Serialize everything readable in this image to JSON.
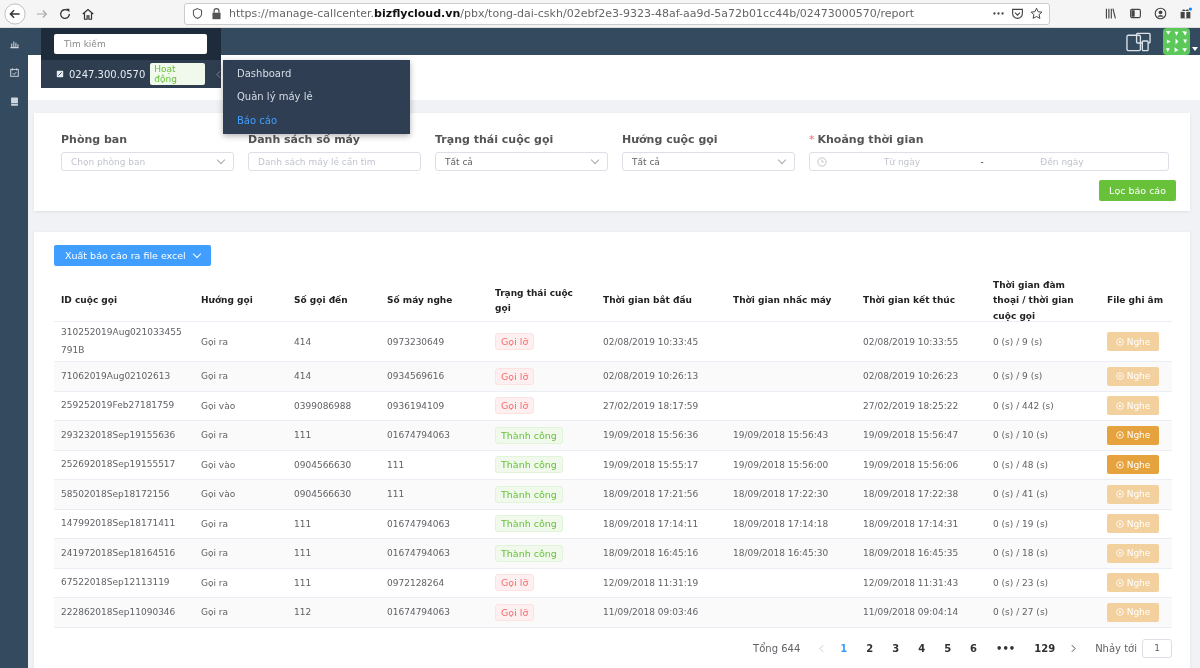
{
  "browser": {
    "url": "https://manage-callcenter.**bizflycloud.vn**/pbx/tong-dai-cskh/02ebf2e3-9323-48af-aa9d-5a72b01cc44b/02473000570/report"
  },
  "search": {
    "placeholder": "Tìm kiếm"
  },
  "line": {
    "number": "0247.300.0570",
    "status": "Hoạt động"
  },
  "menu": [
    {
      "label": "Dashboard",
      "selected": false
    },
    {
      "label": "Quản lý máy lẻ",
      "selected": false
    },
    {
      "label": "Báo cáo",
      "selected": true
    }
  ],
  "filters": {
    "department": {
      "label": "Phòng ban",
      "placeholder": "Chọn phòng ban"
    },
    "extensions": {
      "label": "Danh sách số máy",
      "placeholder": "Danh sách máy lẻ cần tìm"
    },
    "call_status": {
      "label": "Trạng thái cuộc gọi",
      "value": "Tất cả"
    },
    "direction": {
      "label": "Hướng cuộc gọi",
      "value": "Tất cả"
    },
    "period": {
      "label": "Khoảng thời gian",
      "required_mark": "*",
      "from_placeholder": "Từ ngày",
      "separator": "-",
      "to_placeholder": "Đến ngày"
    },
    "submit": "Lọc báo cáo"
  },
  "export_button": "Xuất báo cáo ra file excel",
  "table": {
    "columns": [
      "ID cuộc gọi",
      "Hướng gọi",
      "Số gọi đến",
      "Số máy nghe",
      "Trạng thái cuộc gọi",
      "Thời gian bắt đầu",
      "Thời gian nhấc máy",
      "Thời gian kết thúc",
      "Thời gian đàm thoại / thời gian cuộc gọi",
      "File ghi âm"
    ],
    "rows": [
      {
        "id": "310252019Aug021033455791B",
        "direction": "Gọi ra",
        "caller": "414",
        "receiver": "0973230649",
        "status": {
          "label": "Gọi lỡ",
          "kind": "missed"
        },
        "start": "02/08/2019 10:33:45",
        "answered": "",
        "end": "02/08/2019 10:33:55",
        "duration": "0 (s) / 9 (s)",
        "play": {
          "label": "Nghe",
          "disabled": true
        }
      },
      {
        "id": "71062019Aug02102613",
        "direction": "Gọi ra",
        "caller": "414",
        "receiver": "0934569616",
        "status": {
          "label": "Gọi lỡ",
          "kind": "missed"
        },
        "start": "02/08/2019 10:26:13",
        "answered": "",
        "end": "02/08/2019 10:26:23",
        "duration": "0 (s) / 9 (s)",
        "play": {
          "label": "Nghe",
          "disabled": true
        }
      },
      {
        "id": "259252019Feb27181759",
        "direction": "Gọi vào",
        "caller": "0399086988",
        "receiver": "0936194109",
        "status": {
          "label": "Gọi lỡ",
          "kind": "missed"
        },
        "start": "27/02/2019 18:17:59",
        "answered": "",
        "end": "27/02/2019 18:25:22",
        "duration": "0 (s) / 442 (s)",
        "play": {
          "label": "Nghe",
          "disabled": true
        }
      },
      {
        "id": "293232018Sep19155636",
        "direction": "Gọi ra",
        "caller": "111",
        "receiver": "01674794063",
        "status": {
          "label": "Thành công",
          "kind": "success"
        },
        "start": "19/09/2018 15:56:36",
        "answered": "19/09/2018 15:56:43",
        "end": "19/09/2018 15:56:47",
        "duration": "0 (s) / 10 (s)",
        "play": {
          "label": "Nghe",
          "disabled": false
        }
      },
      {
        "id": "252692018Sep19155517",
        "direction": "Gọi vào",
        "caller": "0904566630",
        "receiver": "111",
        "status": {
          "label": "Thành công",
          "kind": "success"
        },
        "start": "19/09/2018 15:55:17",
        "answered": "19/09/2018 15:56:00",
        "end": "19/09/2018 15:56:06",
        "duration": "0 (s) / 48 (s)",
        "play": {
          "label": "Nghe",
          "disabled": false
        }
      },
      {
        "id": "58502018Sep18172156",
        "direction": "Gọi vào",
        "caller": "0904566630",
        "receiver": "111",
        "status": {
          "label": "Thành công",
          "kind": "success"
        },
        "start": "18/09/2018 17:21:56",
        "answered": "18/09/2018 17:22:30",
        "end": "18/09/2018 17:22:38",
        "duration": "0 (s) / 41 (s)",
        "play": {
          "label": "Nghe",
          "disabled": true
        }
      },
      {
        "id": "147992018Sep18171411",
        "direction": "Gọi ra",
        "caller": "111",
        "receiver": "01674794063",
        "status": {
          "label": "Thành công",
          "kind": "success"
        },
        "start": "18/09/2018 17:14:11",
        "answered": "18/09/2018 17:14:18",
        "end": "18/09/2018 17:14:31",
        "duration": "0 (s) / 19 (s)",
        "play": {
          "label": "Nghe",
          "disabled": true
        }
      },
      {
        "id": "241972018Sep18164516",
        "direction": "Gọi ra",
        "caller": "111",
        "receiver": "01674794063",
        "status": {
          "label": "Thành công",
          "kind": "success"
        },
        "start": "18/09/2018 16:45:16",
        "answered": "18/09/2018 16:45:30",
        "end": "18/09/2018 16:45:35",
        "duration": "0 (s) / 18 (s)",
        "play": {
          "label": "Nghe",
          "disabled": true
        }
      },
      {
        "id": "67522018Sep12113119",
        "direction": "Gọi ra",
        "caller": "111",
        "receiver": "0972128264",
        "status": {
          "label": "Gọi lỡ",
          "kind": "missed"
        },
        "start": "12/09/2018 11:31:19",
        "answered": "",
        "end": "12/09/2018 11:31:43",
        "duration": "0 (s) / 23 (s)",
        "play": {
          "label": "Nghe",
          "disabled": true
        }
      },
      {
        "id": "222862018Sep11090346",
        "direction": "Gọi ra",
        "caller": "112",
        "receiver": "01674794063",
        "status": {
          "label": "Gọi lỡ",
          "kind": "missed"
        },
        "start": "11/09/2018 09:03:46",
        "answered": "",
        "end": "11/09/2018 09:04:14",
        "duration": "0 (s) / 27 (s)",
        "play": {
          "label": "Nghe",
          "disabled": true
        }
      }
    ]
  },
  "pagination": {
    "total": "Tổng 644",
    "pages": [
      {
        "label": "1",
        "selected": true
      },
      {
        "label": "2",
        "selected": false
      },
      {
        "label": "3",
        "selected": false
      },
      {
        "label": "4",
        "selected": false
      },
      {
        "label": "5",
        "selected": false
      },
      {
        "label": "6",
        "selected": false
      },
      {
        "label": "•••",
        "selected": false
      },
      {
        "label": "129",
        "selected": false
      }
    ],
    "jump_label": "Nhảy tới",
    "jump_value": "1"
  }
}
